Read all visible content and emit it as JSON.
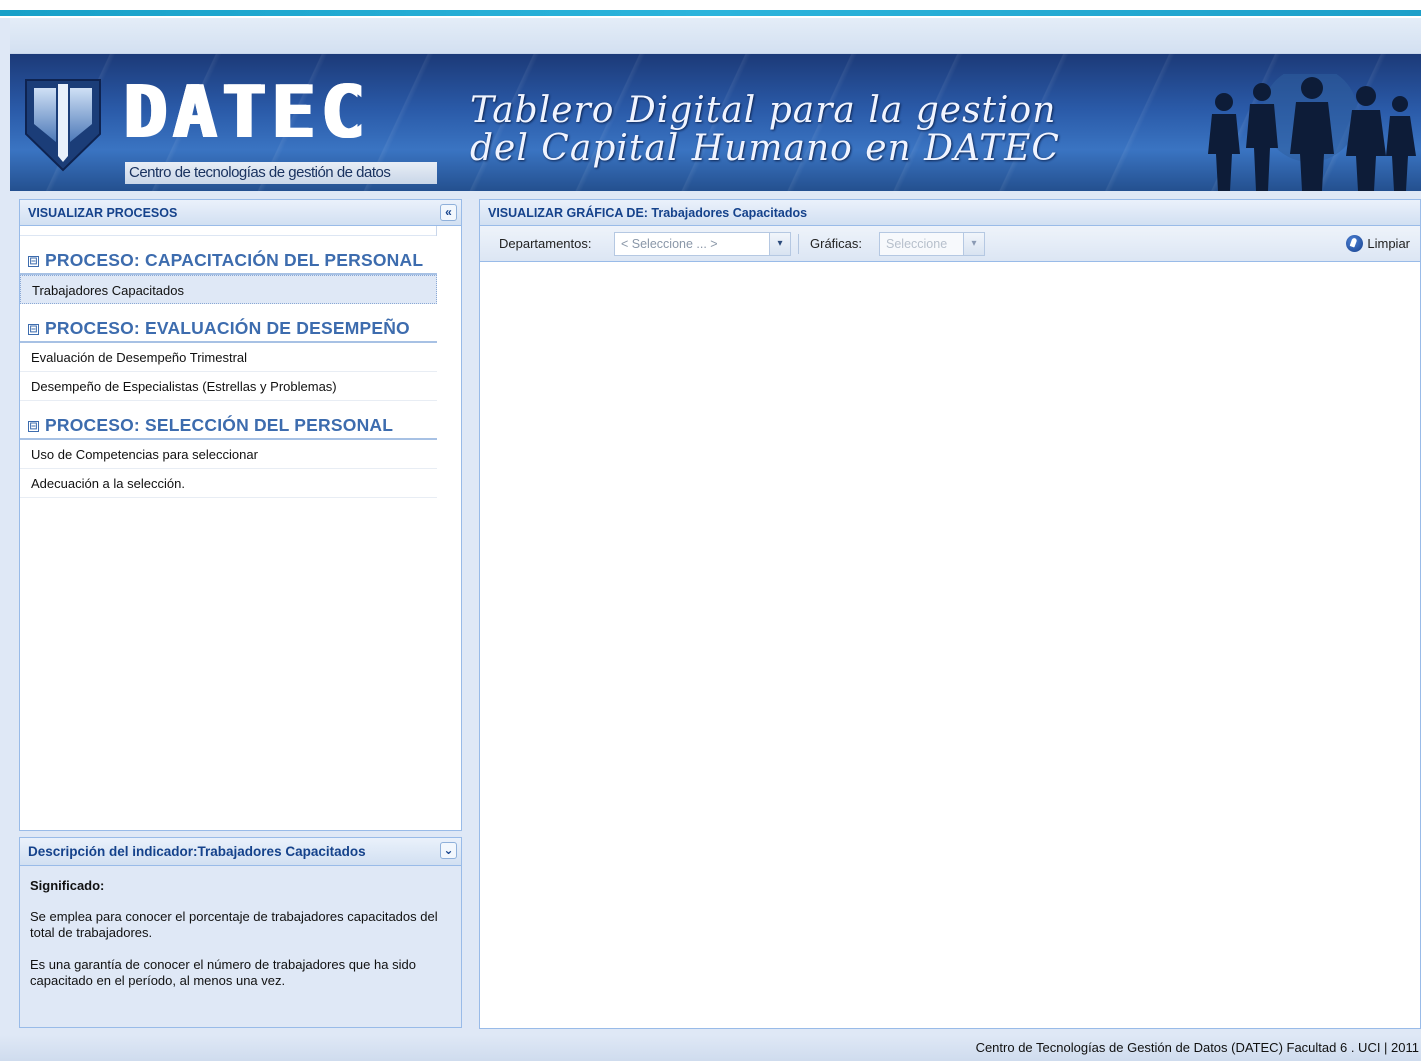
{
  "banner": {
    "logo_word": "DATEC",
    "logo_subtitle": "Centro de tecnologías de gestión de datos",
    "title_line1": "Tablero Digital para la gestion",
    "title_line2": "del Capital Humano en DATEC"
  },
  "left_panel": {
    "title": "VISUALIZAR PROCESOS",
    "collapse_icon": "«",
    "groups": [
      {
        "toggle": "⊟",
        "title": "PROCESO: CAPACITACIÓN DEL PERSONAL",
        "items": [
          {
            "label": "Trabajadores Capacitados",
            "selected": true
          }
        ]
      },
      {
        "toggle": "⊟",
        "title": "PROCESO: EVALUACIÓN DE DESEMPEÑO",
        "items": [
          {
            "label": "Evaluación de Desempeño Trimestral",
            "selected": false
          },
          {
            "label": "Desempeño de Especialistas (Estrellas y Problemas)",
            "selected": false
          }
        ]
      },
      {
        "toggle": "⊟",
        "title": "PROCESO: SELECCIÓN DEL PERSONAL",
        "items": [
          {
            "label": "Uso de Competencias para seleccionar",
            "selected": false
          },
          {
            "label": "Adecuación a la selección.",
            "selected": false
          }
        ]
      }
    ]
  },
  "description": {
    "title": "Descripción del indicador:Trabajadores Capacitados",
    "expand_icon": "⌄",
    "heading": "Significado:",
    "paragraph1": "Se emplea para conocer el porcentaje de trabajadores capacitados del total de trabajadores.",
    "paragraph2": "Es una garantía de conocer el número de trabajadores que ha sido capacitado en el período, al menos una vez."
  },
  "right_panel": {
    "title": "VISUALIZAR GRÁFICA DE: Trabajadores Capacitados",
    "toolbar": {
      "departamentos_label": "Departamentos:",
      "departamentos_value": "< Seleccione ... >",
      "graficas_label": "Gráficas:",
      "graficas_value": "Seleccione",
      "clear_label": "Limpiar",
      "dropdown_icon": "▾"
    }
  },
  "footer": {
    "text": "Centro de Tecnologías de Gestión de Datos (DATEC) Facultad 6 . UCI | 2011"
  },
  "colors": {
    "accent": "#15428b",
    "panel_border": "#99bbe8",
    "group_title": "#3d6cae",
    "banner": "#2a5aa8"
  }
}
